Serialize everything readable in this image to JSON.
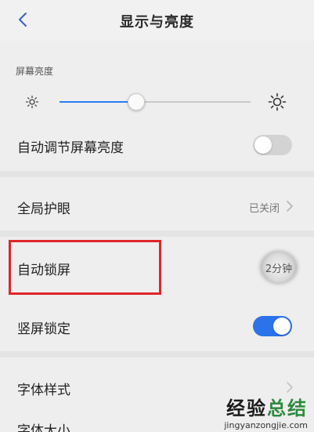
{
  "header": {
    "title": "显示与亮度",
    "back_icon": "back-chevron-icon"
  },
  "brightness": {
    "section_title": "屏幕亮度",
    "level": 0.4,
    "min_icon": "sun-small-icon",
    "max_icon": "sun-large-icon"
  },
  "rows": {
    "auto_brightness": {
      "label": "自动调节屏幕亮度",
      "toggle": "off"
    },
    "eye_protection": {
      "label": "全局护眼",
      "value": "已关闭"
    },
    "auto_lock": {
      "label": "自动锁屏",
      "value": "2分钟"
    },
    "portrait_lock": {
      "label": "竖屏锁定",
      "toggle": "on"
    },
    "font_style": {
      "label": "字体样式"
    },
    "font_size": {
      "label": "字体大小"
    }
  },
  "watermark": {
    "main_part1": "经验",
    "main_part2": "总结",
    "url": "jingyanzongjie.com"
  },
  "colors": {
    "accent_blue": "#2b73e9",
    "highlight_red": "#e0252a",
    "watermark_green": "#2d8a3c"
  }
}
